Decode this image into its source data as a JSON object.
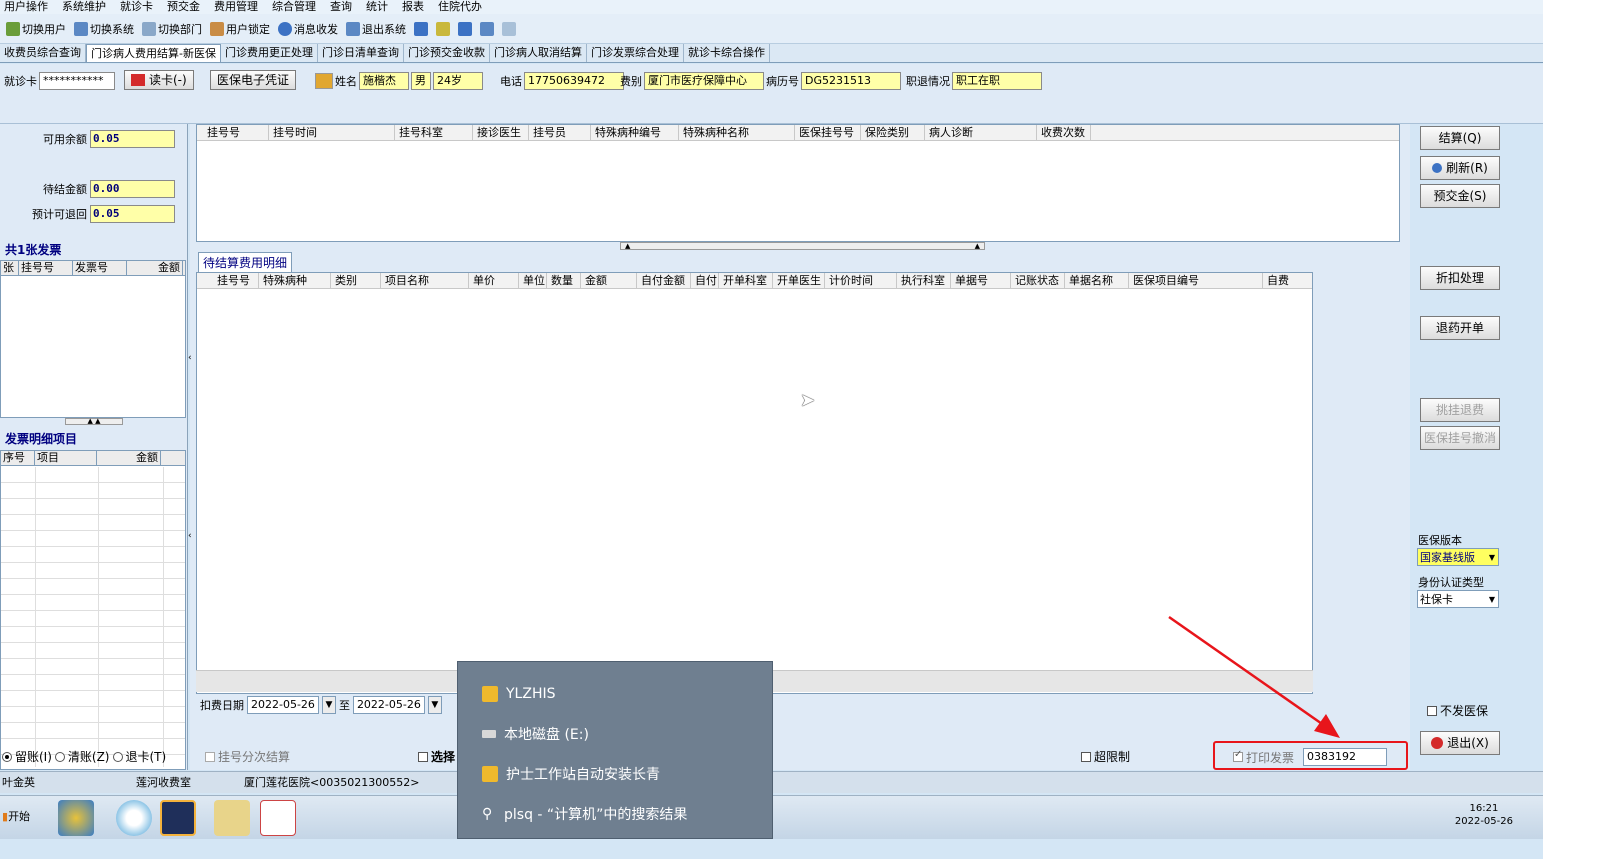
{
  "menu": [
    "用户操作",
    "系统维护",
    "就诊卡",
    "预交金",
    "费用管理",
    "综合管理",
    "查询",
    "统计",
    "报表",
    "住院代办"
  ],
  "toolbar": {
    "switch_user": "切换用户",
    "switch_system": "切换系统",
    "switch_dept": "切换部门",
    "lock_user": "用户锁定",
    "message": "消息收发",
    "exit_system": "退出系统"
  },
  "tabs": [
    "收费员综合查询",
    "门诊病人费用结算-新医保",
    "门诊费用更正处理",
    "门诊日清单查询",
    "门诊预交金收款",
    "门诊病人取消结算",
    "门诊发票综合处理",
    "就诊卡综合操作"
  ],
  "patient": {
    "card_label": "就诊卡",
    "card_value": "***********",
    "read_card": "读卡(-)",
    "insurance_cert": "医保电子凭证",
    "name_label": "姓名",
    "name": "施楷杰",
    "gender": "男",
    "age": "24岁",
    "phone_label": "电话",
    "phone": "17750639472",
    "fee_type_label": "费别",
    "fee_type": "厦门市医疗保障中心",
    "record_label": "病历号",
    "record_no": "DG5231513",
    "job_label": "职退情况",
    "job_status": "职工在职"
  },
  "left": {
    "available_label": "可用余额",
    "available": "0.05",
    "pending_label": "待结金额",
    "pending": "0.00",
    "refund_label": "预计可退回",
    "refund": "0.05",
    "invoice_count": "共1张发票",
    "invoice_cols": [
      "张",
      "挂号号",
      "发票号",
      "金额"
    ],
    "detail_title": "发票明细项目",
    "detail_cols": [
      "序号",
      "项目",
      "金额"
    ]
  },
  "main": {
    "top_cols": [
      "挂号号",
      "挂号时间",
      "挂号科室",
      "接诊医生",
      "挂号员",
      "特殊病种编号",
      "特殊病种名称",
      "医保挂号号",
      "保险类别",
      "病人诊断",
      "收费次数"
    ],
    "detail_tab": "待结算费用明细",
    "bottom_cols": [
      "挂号号",
      "特殊病种",
      "类别",
      "项目名称",
      "单价",
      "单位",
      "数量",
      "金额",
      "自付金额",
      "自付",
      "开单科室",
      "开单医生",
      "计价时间",
      "执行科室",
      "单据号",
      "记账状态",
      "单据名称",
      "医保项目编号",
      "自费"
    ],
    "date_label": "扣费日期",
    "date_from": "2022-05-26",
    "to_label": "至",
    "date_to": "2022-05-26"
  },
  "right": {
    "settle": "结算(Q)",
    "refresh": "刷新(R)",
    "prepay": "预交金(S)",
    "discount": "折扣处理",
    "return_drug": "退药开单",
    "pick_refund": "挑挂退费",
    "cancel_reg": "医保挂号撤消",
    "version_label": "医保版本",
    "version": "国家基线版",
    "id_type_label": "身份认证类型",
    "id_type": "社保卡",
    "no_insurance": "不发医保",
    "exit": "退出(X)"
  },
  "options": {
    "keep": "留账(I)",
    "clear": "清账(Z)",
    "return_card": "退卡(T)",
    "split": "挂号分次结算",
    "select": "选择",
    "over_limit": "超限制",
    "print_invoice": "打印发票",
    "invoice_no": "0383192"
  },
  "status": {
    "user": "叶金英",
    "office": "莲河收费室",
    "hospital": "厦门莲花医院<0035021300552>"
  },
  "taskbar": {
    "start": "开始",
    "time": "16:21",
    "date": "2022-05-26"
  },
  "popup": {
    "items": [
      "YLZHIS",
      "本地磁盘 (E:)",
      "护士工作站自动安装长青",
      "plsq - “计算机”中的搜索结果"
    ]
  },
  "colors": {
    "highlight": "#e8151b",
    "field_yellow": "#ffffa8",
    "app_bg": "#d4e6f5"
  }
}
